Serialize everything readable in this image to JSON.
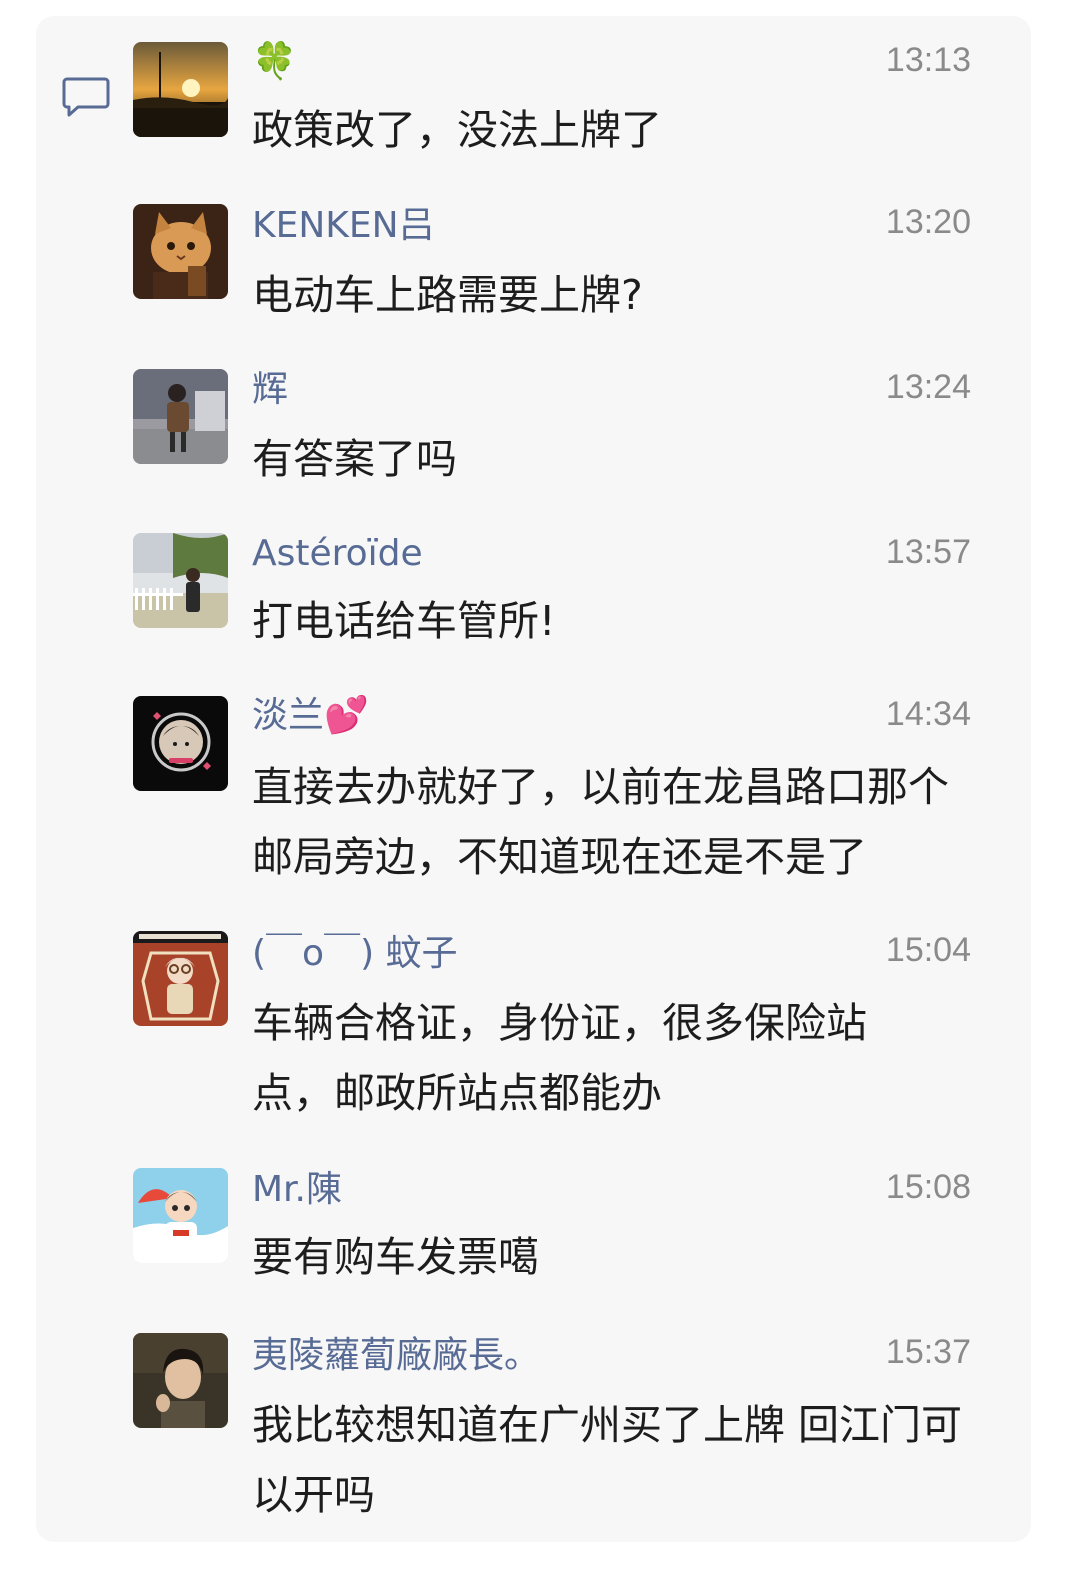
{
  "comments": [
    {
      "name": "🍀",
      "time": "13:13",
      "text": "政策改了，没法上牌了"
    },
    {
      "name": "KENKEN吕",
      "time": "13:20",
      "text": "电动车上路需要上牌?"
    },
    {
      "name": "辉",
      "time": "13:24",
      "text": "有答案了吗"
    },
    {
      "name": "Astéroïde",
      "time": "13:57",
      "text": "打电话给车管所!"
    },
    {
      "name": "淡兰💕",
      "time": "14:34",
      "text": "直接去办就好了，以前在龙昌路口那个邮局旁边，不知道现在还是不是了"
    },
    {
      "name": "(￣o￣) 蚊子",
      "time": "15:04",
      "text": "车辆合格证，身份证，很多保险站点，邮政所站点都能办"
    },
    {
      "name": "Mr.陳",
      "time": "15:08",
      "text": "要有购车发票噶"
    },
    {
      "name": "夷陵蘿蔔廠廠長。",
      "time": "15:37",
      "text": "我比较想知道在广州买了上牌 回江门可以开吗"
    }
  ],
  "icons": {
    "comment": "comment-bubble-icon"
  },
  "colors": {
    "name": "#576b95",
    "time": "#8a8a8a",
    "text": "#1d1d1d",
    "panel": "#f7f7f7",
    "icon": "#576b95"
  }
}
